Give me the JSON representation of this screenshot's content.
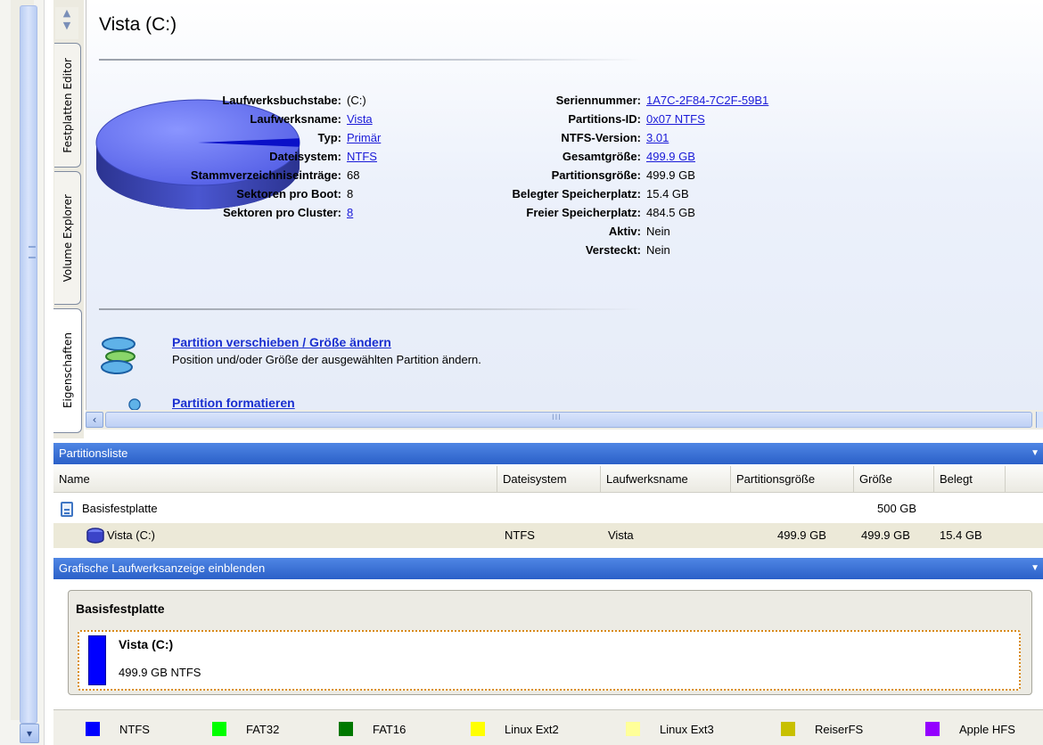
{
  "side_tabs": [
    {
      "label": "Festplatten Editor"
    },
    {
      "label": "Volume Explorer"
    },
    {
      "label": "Eigenschaften"
    }
  ],
  "volume": {
    "title": "Vista (C:)",
    "left_props": [
      {
        "key": "Laufwerksbuchstabe:",
        "value": "(C:)",
        "link": false
      },
      {
        "key": "Laufwerksname:",
        "value": "Vista",
        "link": true
      },
      {
        "key": "Typ:",
        "value": "Primär",
        "link": true
      },
      {
        "key": "Dateisystem:",
        "value": "NTFS",
        "link": true
      },
      {
        "key": "Stammverzeichniseinträge:",
        "value": "68",
        "link": false
      },
      {
        "key": "Sektoren pro Boot:",
        "value": "8",
        "link": false
      },
      {
        "key": "Sektoren pro Cluster:",
        "value": "8",
        "link": true
      }
    ],
    "right_props": [
      {
        "key": "Seriennummer:",
        "value": "1A7C-2F84-7C2F-59B1",
        "link": true
      },
      {
        "key": "Partitions-ID:",
        "value": "0x07 NTFS",
        "link": true
      },
      {
        "key": "NTFS-Version:",
        "value": "3.01",
        "link": true
      },
      {
        "key": "Gesamtgröße:",
        "value": "499.9 GB",
        "link": true
      },
      {
        "key": "Partitionsgröße:",
        "value": "499.9 GB",
        "link": false
      },
      {
        "key": "Belegter Speicherplatz:",
        "value": "15.4 GB",
        "link": false
      },
      {
        "key": "Freier Speicherplatz:",
        "value": "484.5 GB",
        "link": false
      },
      {
        "key": "Aktiv:",
        "value": "Nein",
        "link": false
      },
      {
        "key": "Versteckt:",
        "value": "Nein",
        "link": false
      }
    ],
    "used_fraction": 0.031
  },
  "actions": [
    {
      "title": "Partition verschieben / Größe ändern",
      "description": "Position und/oder Größe der ausgewählten Partition ändern."
    },
    {
      "title": "Partition formatieren",
      "description": ""
    }
  ],
  "partition_list": {
    "header": "Partitionsliste",
    "columns": [
      "Name",
      "Dateisystem",
      "Laufwerksname",
      "Partitionsgröße",
      "Größe",
      "Belegt"
    ],
    "disk_row": {
      "name": "Basisfestplatte",
      "size": "500 GB"
    },
    "volume_row": {
      "name": "Vista (C:)",
      "filesystem": "NTFS",
      "label": "Vista",
      "partition_size": "499.9 GB",
      "size": "499.9 GB",
      "used": "15.4 GB"
    }
  },
  "graphic_view": {
    "header": "Grafische Laufwerksanzeige einblenden",
    "disk_title": "Basisfestplatte",
    "partition_name": "Vista (C:)",
    "partition_info": "499.9 GB NTFS"
  },
  "legend": [
    {
      "label": "NTFS",
      "color": "#0000ff"
    },
    {
      "label": "FAT32",
      "color": "#00ff00"
    },
    {
      "label": "FAT16",
      "color": "#007800"
    },
    {
      "label": "Linux Ext2",
      "color": "#ffff00"
    },
    {
      "label": "Linux Ext3",
      "color": "#ffff99"
    },
    {
      "label": "ReiserFS",
      "color": "#c8c000"
    },
    {
      "label": "Apple HFS",
      "color": "#9400ff"
    }
  ]
}
